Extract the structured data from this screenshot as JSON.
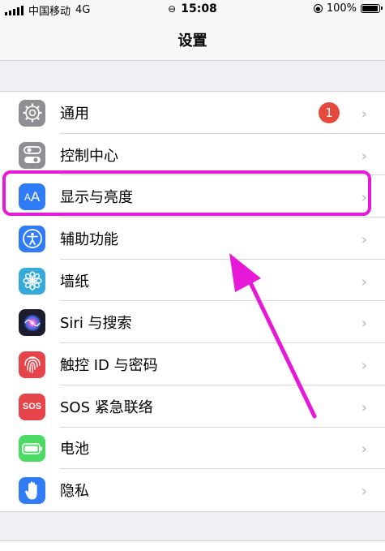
{
  "status_bar": {
    "carrier": "中国移动",
    "network": "4G",
    "time": "15:08",
    "battery": "100%",
    "battery_level": 1.0
  },
  "nav": {
    "title": "设置"
  },
  "settings": [
    {
      "key": "general",
      "label": "通用",
      "badge": "1",
      "icon": "gear-icon",
      "color": "#8e8e93"
    },
    {
      "key": "control-center",
      "label": "控制中心",
      "icon": "toggle-switches-icon",
      "color": "#8e8e93"
    },
    {
      "key": "display-brightness",
      "label": "显示与亮度",
      "icon": "text-size-aa-icon",
      "color": "#2f7cf6"
    },
    {
      "key": "accessibility",
      "label": "辅助功能",
      "icon": "accessibility-person-icon",
      "color": "#2f7cf6"
    },
    {
      "key": "wallpaper",
      "label": "墙纸",
      "icon": "flower-icon",
      "color": "#35aadc"
    },
    {
      "key": "siri-search",
      "label": "Siri 与搜索",
      "icon": "siri-icon",
      "color": "#1c1c2e"
    },
    {
      "key": "touch-id-passcode",
      "label": "触控 ID 与密码",
      "icon": "fingerprint-icon",
      "color": "#e5454a"
    },
    {
      "key": "emergency-sos",
      "label": "SOS 紧急联络",
      "icon_text": "SOS",
      "icon": "sos-icon",
      "color": "#e5454a"
    },
    {
      "key": "battery",
      "label": "电池",
      "icon": "battery-icon",
      "color": "#4cd964"
    },
    {
      "key": "privacy",
      "label": "隐私",
      "icon": "hand-icon",
      "color": "#2f7cf6"
    }
  ],
  "annotation": {
    "highlight_color": "#e719d8"
  }
}
